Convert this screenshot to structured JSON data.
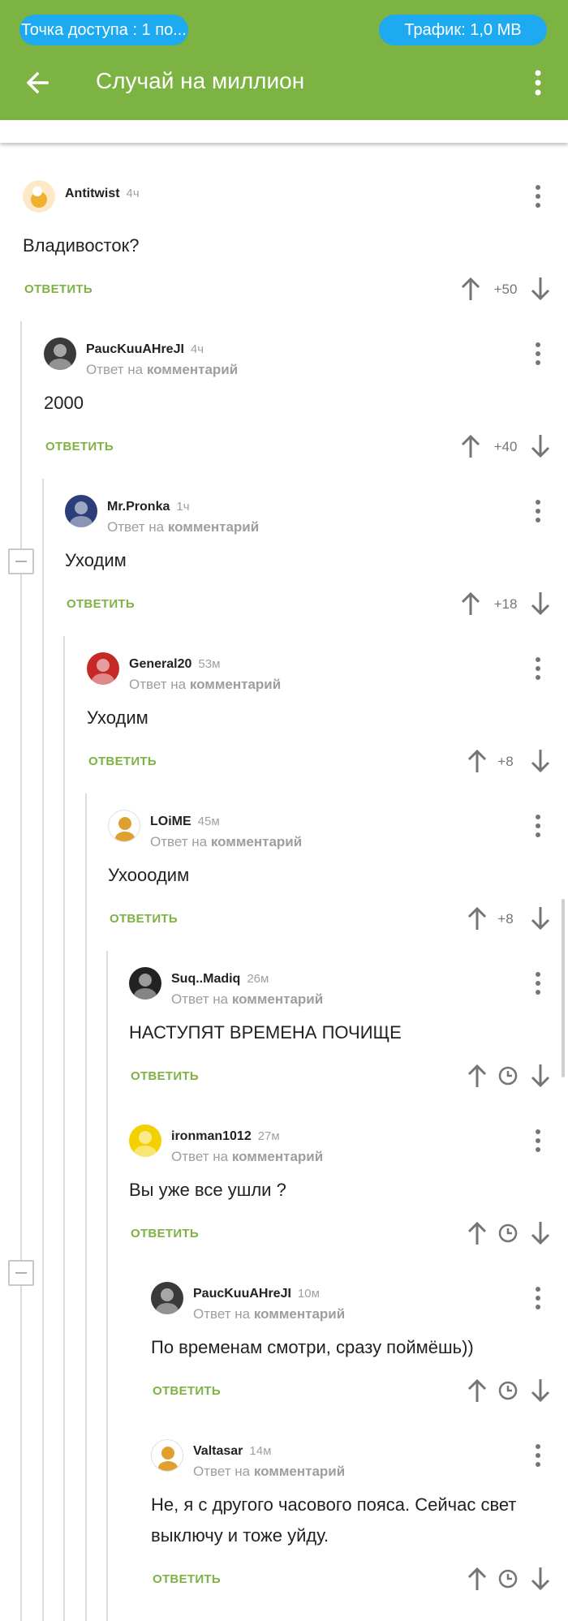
{
  "status": {
    "hotspot": "Точка доступа : 1 по...",
    "traffic": "Трафик: 1,0 MB"
  },
  "header": {
    "title": "Случай на миллион",
    "back_icon": "arrow-left-icon",
    "menu_icon": "more-vert-icon"
  },
  "colors": {
    "appbar": "#7cb342",
    "pill": "#1eaaf1",
    "reply": "#7cb342"
  },
  "reply_label": "ОТВЕТИТЬ",
  "reply_to_prefix": "Ответ на",
  "reply_to_target": "комментарий",
  "comments": [
    {
      "author": "Antitwist",
      "time": "4ч",
      "text": "Владивосток?",
      "score": "+50",
      "reply_to": false
    },
    {
      "author": "PaucKuuAHreJI",
      "time": "4ч",
      "text": "2000",
      "score": "+40",
      "reply_to": true
    },
    {
      "author": "Mr.Pronka",
      "time": "1ч",
      "text": "Уходим",
      "score": "+18",
      "reply_to": true
    },
    {
      "author": "General20",
      "time": "53м",
      "text": "Уходим",
      "score": "+8",
      "reply_to": true
    },
    {
      "author": "LOiME",
      "time": "45м",
      "text": "Ухооодим",
      "score": "+8",
      "reply_to": true
    },
    {
      "author": "Suq..Madiq",
      "time": "26м",
      "text": "НАСТУПЯТ ВРЕМЕНА ПОЧИЩЕ",
      "score": null,
      "reply_to": true
    },
    {
      "author": "ironman1012",
      "time": "27м",
      "text": "Вы уже все ушли ?",
      "score": null,
      "reply_to": true
    },
    {
      "author": "PaucKuuAHreJI",
      "time": "10м",
      "text": "По временам смотри, сразу поймёшь))",
      "score": null,
      "reply_to": true
    },
    {
      "author": "Valtasar",
      "time": "14м",
      "text": "Не, я с другого часового пояса. Сейчас свет выключу и тоже уйду.",
      "score": null,
      "reply_to": true
    }
  ]
}
